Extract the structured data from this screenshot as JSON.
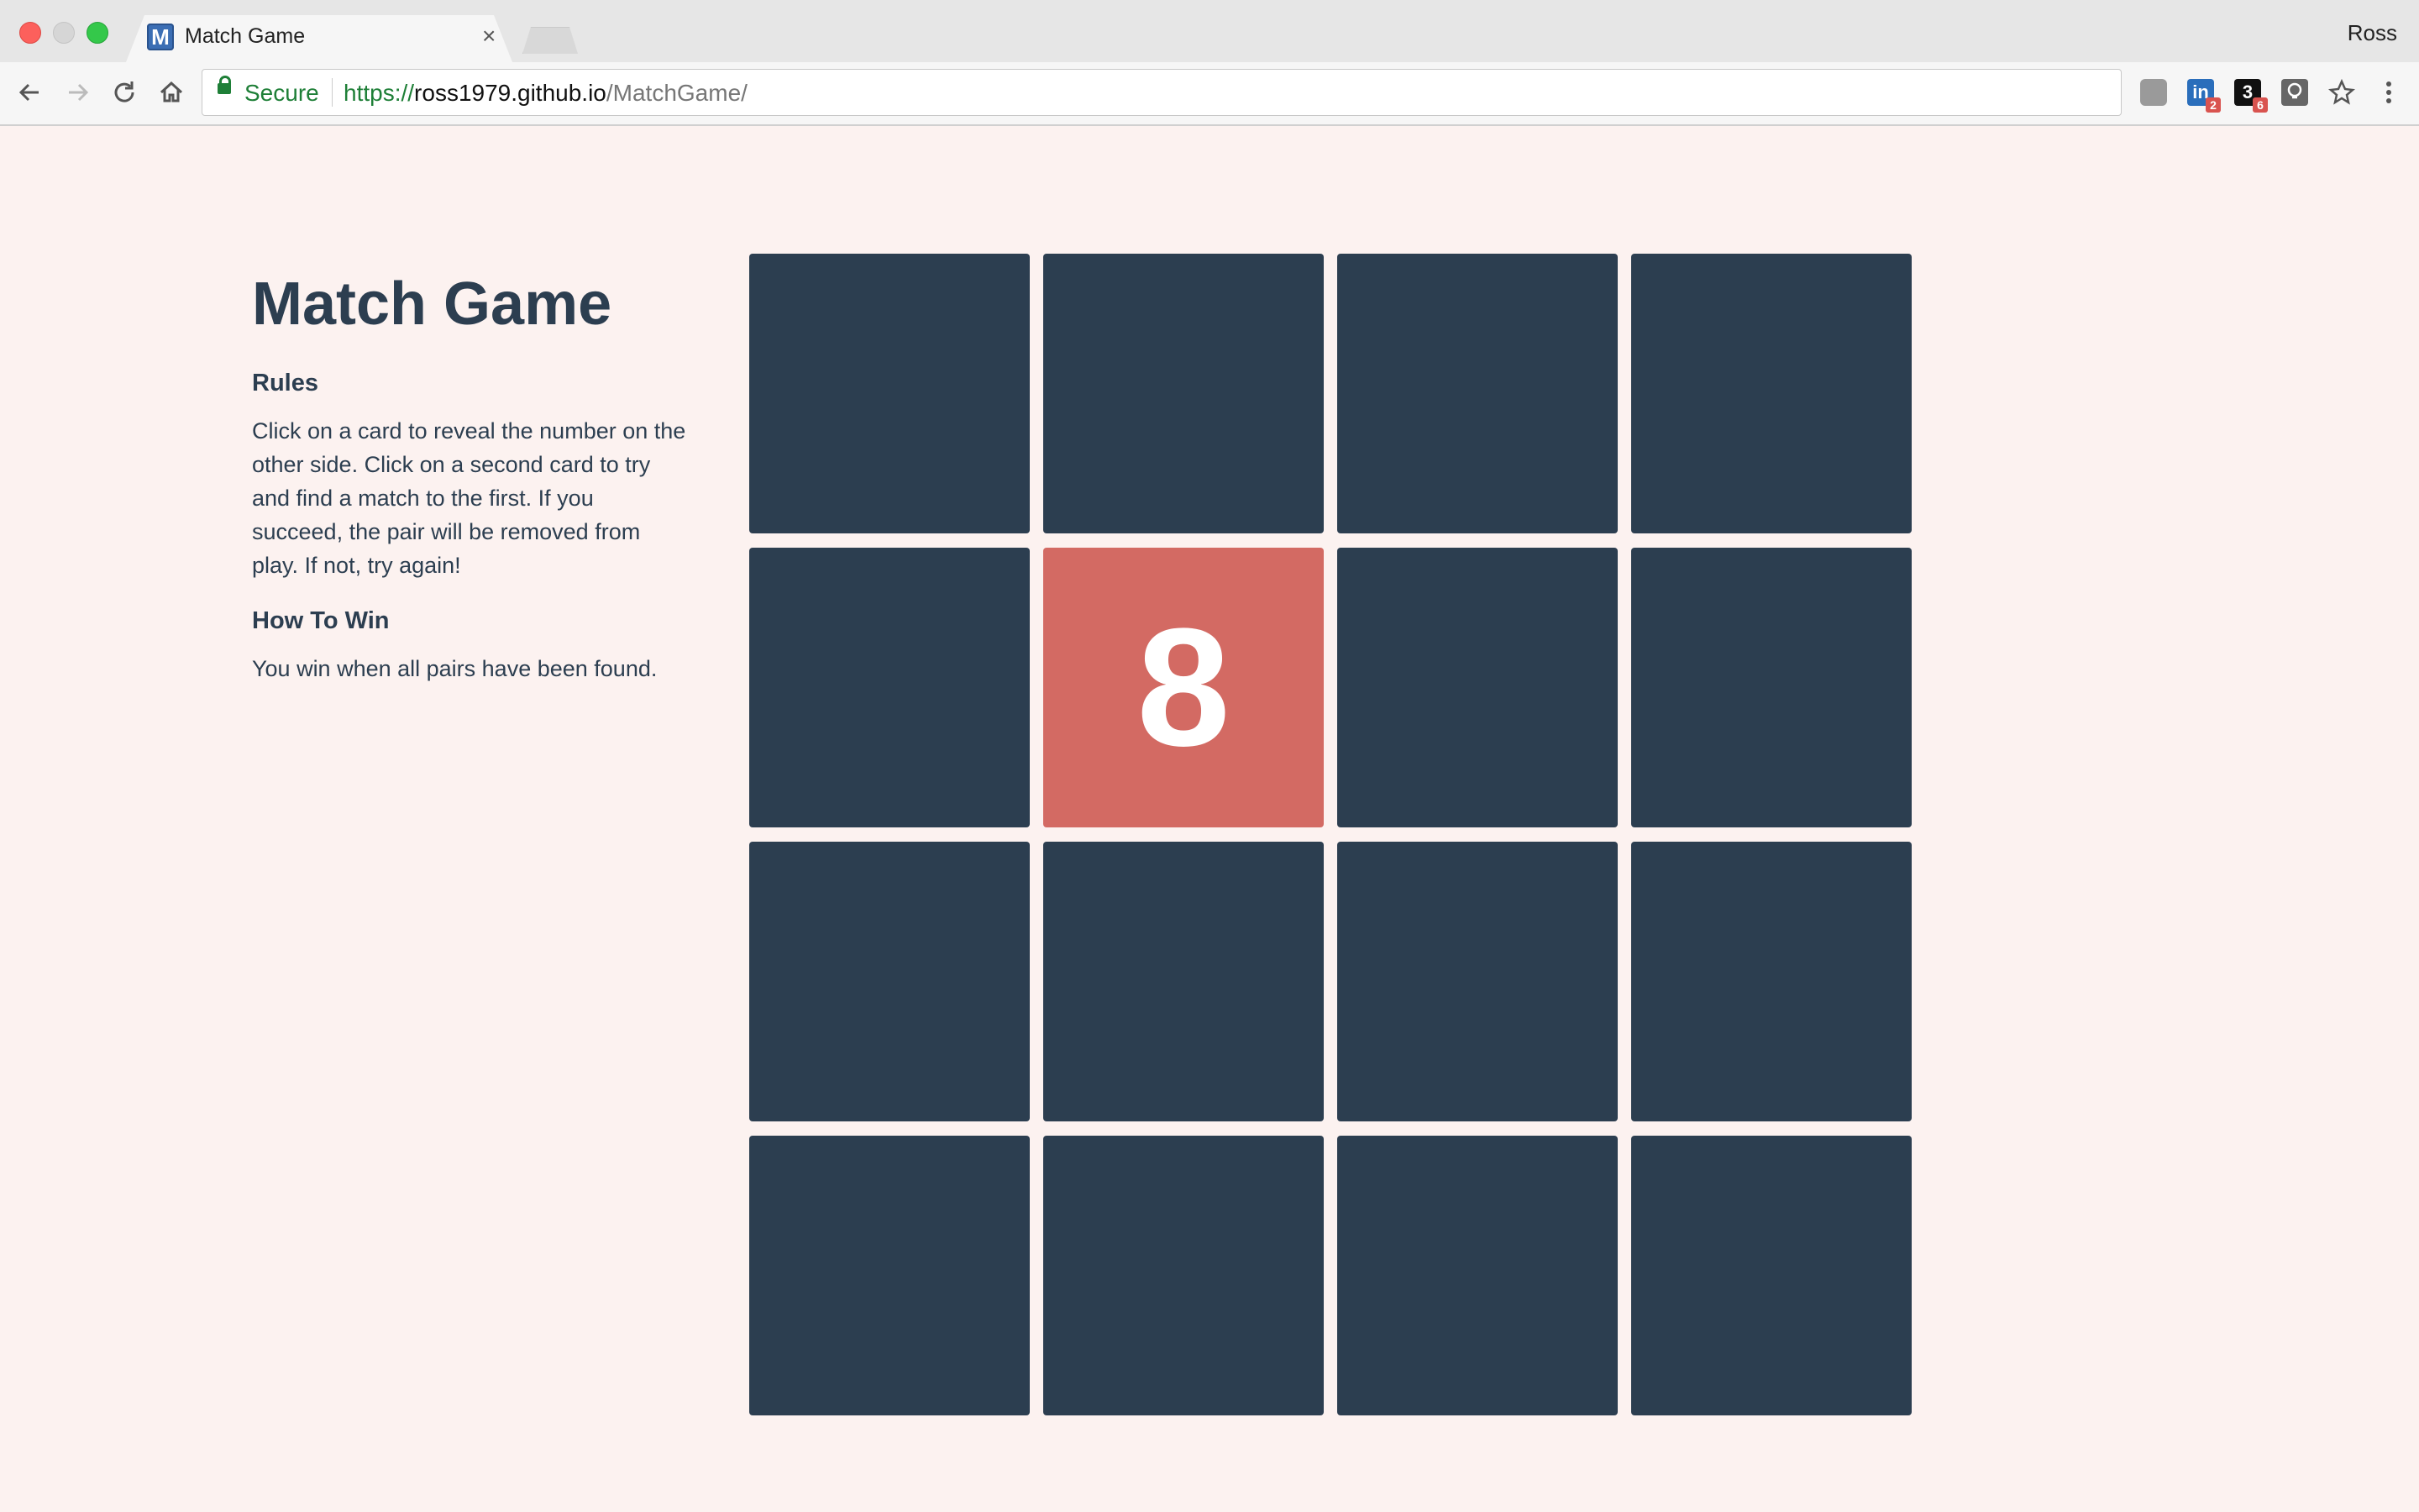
{
  "browser": {
    "tab": {
      "title": "Match Game",
      "favicon_letter": "M"
    },
    "profile_name": "Ross",
    "address_bar": {
      "security_label": "Secure",
      "url_scheme": "https://",
      "url_host": "ross1979.github.io",
      "url_path": "/MatchGame/"
    },
    "extensions": [
      {
        "name": "extension-grey",
        "badge": ""
      },
      {
        "name": "linkedin-extension",
        "label": "in",
        "badge": "2"
      },
      {
        "name": "extension-3",
        "label": "3",
        "badge": "6"
      },
      {
        "name": "lightbulb-extension",
        "badge": ""
      }
    ]
  },
  "page": {
    "title": "Match Game",
    "rules_heading": "Rules",
    "rules_text": "Click on a card to reveal the number on the other side. Click on a second card to try and find a match to the first. If you succeed, the pair will be removed from play. If not, try again!",
    "win_heading": "How To Win",
    "win_text": "You win when all pairs have been found."
  },
  "colors": {
    "card_back": "#2c3e50",
    "card_flipped": "#d36a63",
    "page_background": "#fcf2f0",
    "text": "#2c3e50"
  },
  "board": {
    "cards": [
      {
        "value": "",
        "flipped": false
      },
      {
        "value": "",
        "flipped": false
      },
      {
        "value": "",
        "flipped": false
      },
      {
        "value": "",
        "flipped": false
      },
      {
        "value": "",
        "flipped": false
      },
      {
        "value": "8",
        "flipped": true
      },
      {
        "value": "",
        "flipped": false
      },
      {
        "value": "",
        "flipped": false
      },
      {
        "value": "",
        "flipped": false
      },
      {
        "value": "",
        "flipped": false
      },
      {
        "value": "",
        "flipped": false
      },
      {
        "value": "",
        "flipped": false
      },
      {
        "value": "",
        "flipped": false
      },
      {
        "value": "",
        "flipped": false
      },
      {
        "value": "",
        "flipped": false
      },
      {
        "value": "",
        "flipped": false
      }
    ]
  }
}
